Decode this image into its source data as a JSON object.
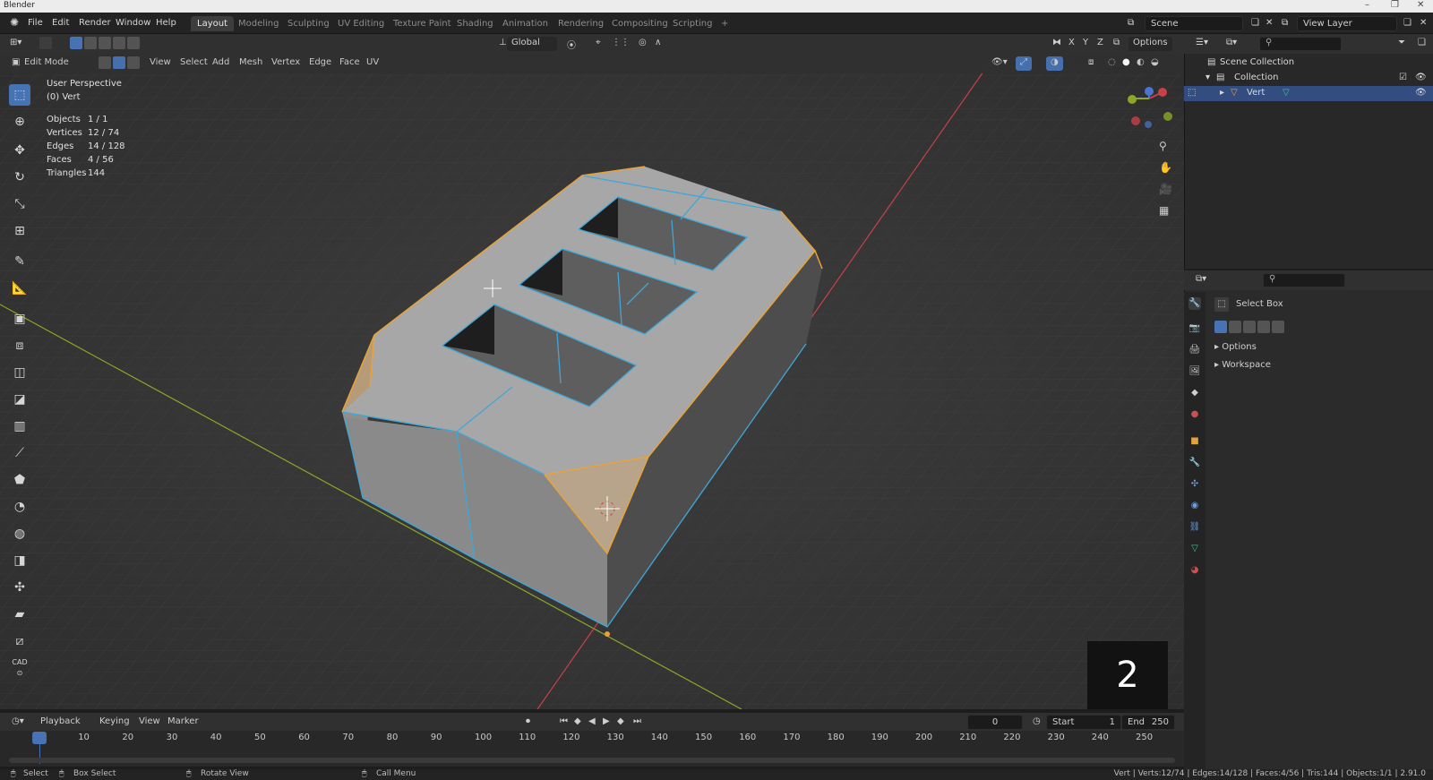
{
  "window": {
    "title": "Blender"
  },
  "menu": [
    "File",
    "Edit",
    "Render",
    "Window",
    "Help"
  ],
  "workspaces": [
    "Layout",
    "Modeling",
    "Sculpting",
    "UV Editing",
    "Texture Paint",
    "Shading",
    "Animation",
    "Rendering",
    "Compositing",
    "Scripting"
  ],
  "workspace_add": "+",
  "scene_field": "Scene",
  "view_layer_field": "View Layer",
  "viewport_header": {
    "orientation": "Global",
    "options": "Options",
    "axis_x": "X",
    "axis_y": "Y",
    "axis_z": "Z",
    "mode": "Edit Mode",
    "menus": [
      "View",
      "Select",
      "Add",
      "Mesh",
      "Vertex",
      "Edge",
      "Face",
      "UV"
    ]
  },
  "overlay": {
    "view_name": "User Perspective",
    "object_name": "(0) Vert",
    "stats": [
      {
        "label": "Objects",
        "value": "1 / 1"
      },
      {
        "label": "Vertices",
        "value": "12 / 74"
      },
      {
        "label": "Edges",
        "value": "14 / 128"
      },
      {
        "label": "Faces",
        "value": "4 / 56"
      },
      {
        "label": "Triangles",
        "value": "144"
      }
    ]
  },
  "badge": "2",
  "outliner": {
    "scene_collection": "Scene Collection",
    "collection": "Collection",
    "object": "Vert"
  },
  "properties": {
    "tool_name": "Select Box",
    "sections": [
      "Options",
      "Workspace"
    ]
  },
  "timeline": {
    "menus": [
      "Playback",
      "Keying",
      "View",
      "Marker"
    ],
    "current_frame": "0",
    "start_label": "Start",
    "start_value": "1",
    "end_label": "End",
    "end_value": "250",
    "ticks": [
      "0",
      "10",
      "20",
      "30",
      "40",
      "50",
      "60",
      "70",
      "80",
      "90",
      "100",
      "110",
      "120",
      "130",
      "140",
      "150",
      "160",
      "170",
      "180",
      "190",
      "200",
      "210",
      "220",
      "230",
      "240",
      "250"
    ]
  },
  "statusbar": {
    "select": "Select",
    "box_select": "Box Select",
    "rotate_view": "Rotate View",
    "call_menu": "Call Menu",
    "stats": "Vert | Verts:12/74 | Edges:14/128 | Faces:4/56 | Tris:144 | Objects:1/1 | 2.91.0"
  },
  "colors": {
    "accent": "#4772b3",
    "selection_orange": "#e8a23a",
    "edge_blue": "#3ea7d9",
    "x_axis": "#c8404a",
    "y_axis": "#8aa826"
  }
}
